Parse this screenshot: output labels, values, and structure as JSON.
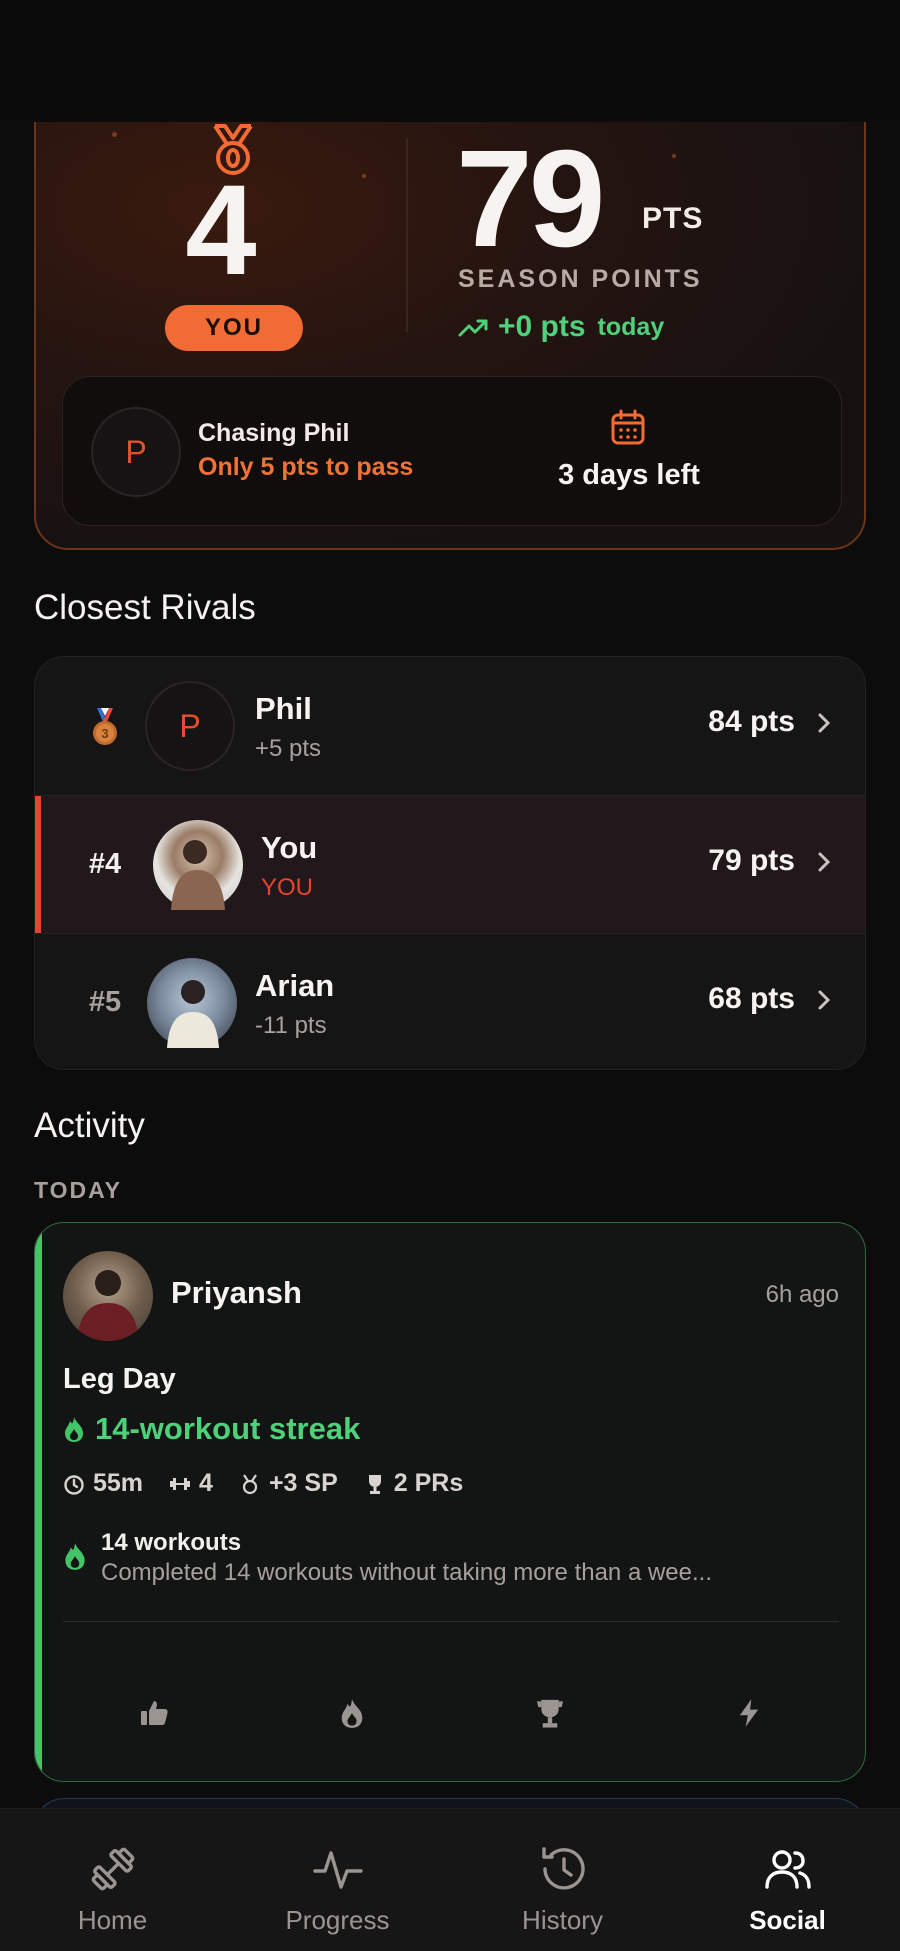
{
  "hero": {
    "rank": "4",
    "you_label": "YOU",
    "points": "79",
    "points_unit": "PTS",
    "season_label": "SEASON POINTS",
    "trend_value": "+0 pts",
    "trend_suffix": "today",
    "chase_avatar_letter": "P",
    "chase_title": "Chasing Phil",
    "chase_sub": "Only 5 pts to pass",
    "days_left": "3 days left",
    "accent_color": "#f26a34"
  },
  "rivals": {
    "title": "Closest Rivals",
    "rows": [
      {
        "rank": "",
        "avatar_letter": "P",
        "name": "Phil",
        "sub": "+5 pts",
        "points": "84 pts"
      },
      {
        "rank": "#4",
        "name": "You",
        "sub": "YOU",
        "points": "79 pts"
      },
      {
        "rank": "#5",
        "name": "Arian",
        "sub": "-11 pts",
        "points": "68 pts"
      }
    ]
  },
  "activity": {
    "title": "Activity",
    "day_label": "TODAY",
    "post": {
      "name": "Priyansh",
      "time": "6h ago",
      "workout_title": "Leg Day",
      "streak": "14-workout streak",
      "stats": {
        "duration": "55m",
        "exercises": "4",
        "sp": "+3 SP",
        "prs": "2 PRs"
      },
      "badge_title": "14 workouts",
      "badge_desc": "Completed 14 workouts without taking more than a wee..."
    }
  },
  "tabs": [
    {
      "label": "Home"
    },
    {
      "label": "Progress"
    },
    {
      "label": "History"
    },
    {
      "label": "Social"
    }
  ]
}
